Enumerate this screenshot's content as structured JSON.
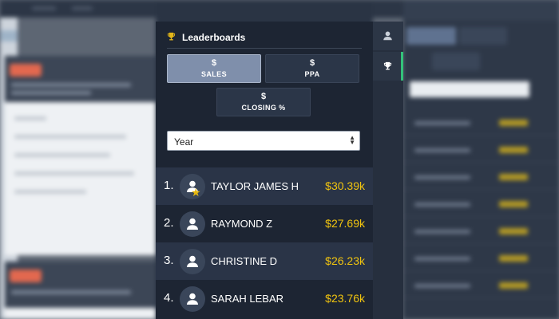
{
  "panel": {
    "title": "Leaderboards"
  },
  "metrics": [
    {
      "symbol": "$",
      "label": "SALES",
      "active": true
    },
    {
      "symbol": "$",
      "label": "PPA",
      "active": false
    },
    {
      "symbol": "$",
      "label": "CLOSING %",
      "active": false
    }
  ],
  "period_select": {
    "value": "Year"
  },
  "leaderboard": [
    {
      "rank": "1.",
      "name": "TAYLOR JAMES H",
      "value": "$30.39k",
      "starred": true
    },
    {
      "rank": "2.",
      "name": "RAYMOND Z",
      "value": "$27.69k",
      "starred": false
    },
    {
      "rank": "3.",
      "name": "CHRISTINE D",
      "value": "$26.23k",
      "starred": false
    },
    {
      "rank": "4.",
      "name": "SARAH LEBAR",
      "value": "$23.76k",
      "starred": false
    }
  ],
  "side_toolbar": [
    {
      "icon": "user-icon",
      "active": false
    },
    {
      "icon": "trophy-icon",
      "active": true
    }
  ],
  "colors": {
    "panel_bg": "#1d2533",
    "row_alt_bg": "#2a3447",
    "active_metric_bg": "#7f8fab",
    "value_text": "#f1c40f",
    "star": "#e8b90e",
    "trophy": "#e3b619",
    "side_active_indicator": "#33c27a"
  }
}
